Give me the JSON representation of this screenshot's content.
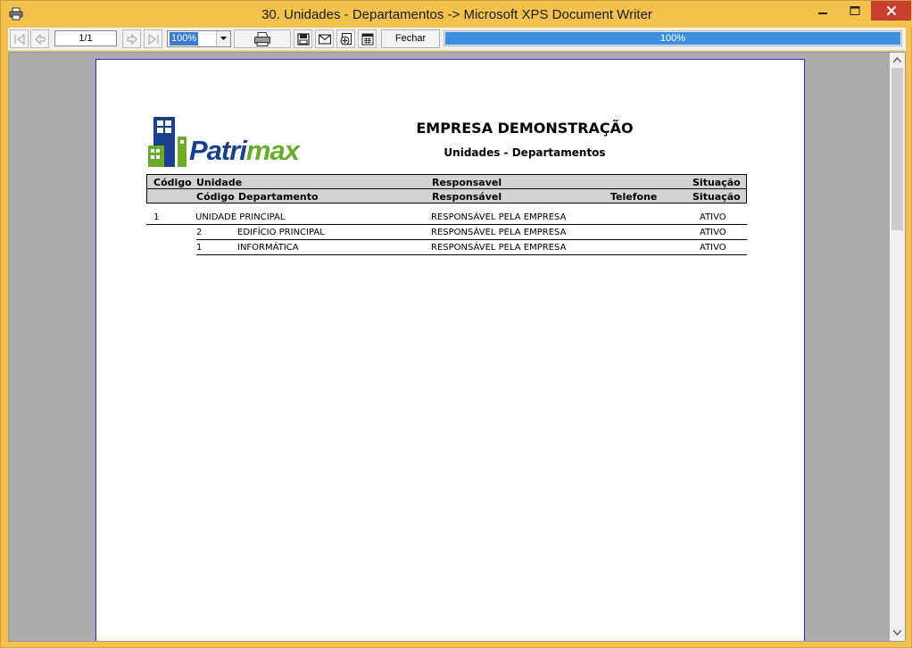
{
  "window": {
    "title": "30. Unidades - Departamentos -> Microsoft XPS Document Writer"
  },
  "toolbar": {
    "page_indicator": "1/1",
    "zoom_value": "100%",
    "close_label": "Fechar",
    "progress_text": "100%",
    "progress_value": 100
  },
  "report": {
    "logo_text_a": "Patri",
    "logo_text_b": "max",
    "company": "EMPRESA DEMONSTRAÇÃO",
    "subtitle": "Unidades - Departamentos",
    "header1": {
      "codigo": "Código",
      "unidade": "Unidade",
      "responsavel": "Responsavel",
      "situacao": "Situação"
    },
    "header2": {
      "codigo": "Código",
      "departamento": "Departamento",
      "responsavel": "Responsável",
      "telefone": "Telefone",
      "situacao": "Situação"
    },
    "unit": {
      "codigo": "1",
      "nome": "UNIDADE PRINCIPAL",
      "responsavel": "RESPONSÁVEL PELA EMPRESA",
      "situacao": "ATIVO"
    },
    "departments": [
      {
        "codigo": "2",
        "nome": "EDIFÍCIO PRINCIPAL",
        "responsavel": "RESPONSÁVEL PELA EMPRESA",
        "telefone": "",
        "situacao": "ATIVO"
      },
      {
        "codigo": "1",
        "nome": "INFORMÁTICA",
        "responsavel": "RESPONSÁVEL PELA EMPRESA",
        "telefone": "",
        "situacao": "ATIVO"
      }
    ]
  },
  "colors": {
    "window_frame": "#f4c24c",
    "close_button": "#c7402d",
    "progress_fill": "#3d8ee0",
    "page_border": "#2c2ccc",
    "logo_blue": "#1b3f8f",
    "logo_green": "#6aab2a"
  },
  "icons": [
    "printer-icon",
    "minimize-icon",
    "maximize-icon",
    "close-icon",
    "first-page-icon",
    "prev-page-icon",
    "next-page-icon",
    "last-page-icon",
    "dropdown-arrow-icon",
    "print-icon",
    "save-icon",
    "email-icon",
    "export-icon",
    "setup-icon",
    "scroll-up-icon",
    "scroll-down-icon"
  ]
}
